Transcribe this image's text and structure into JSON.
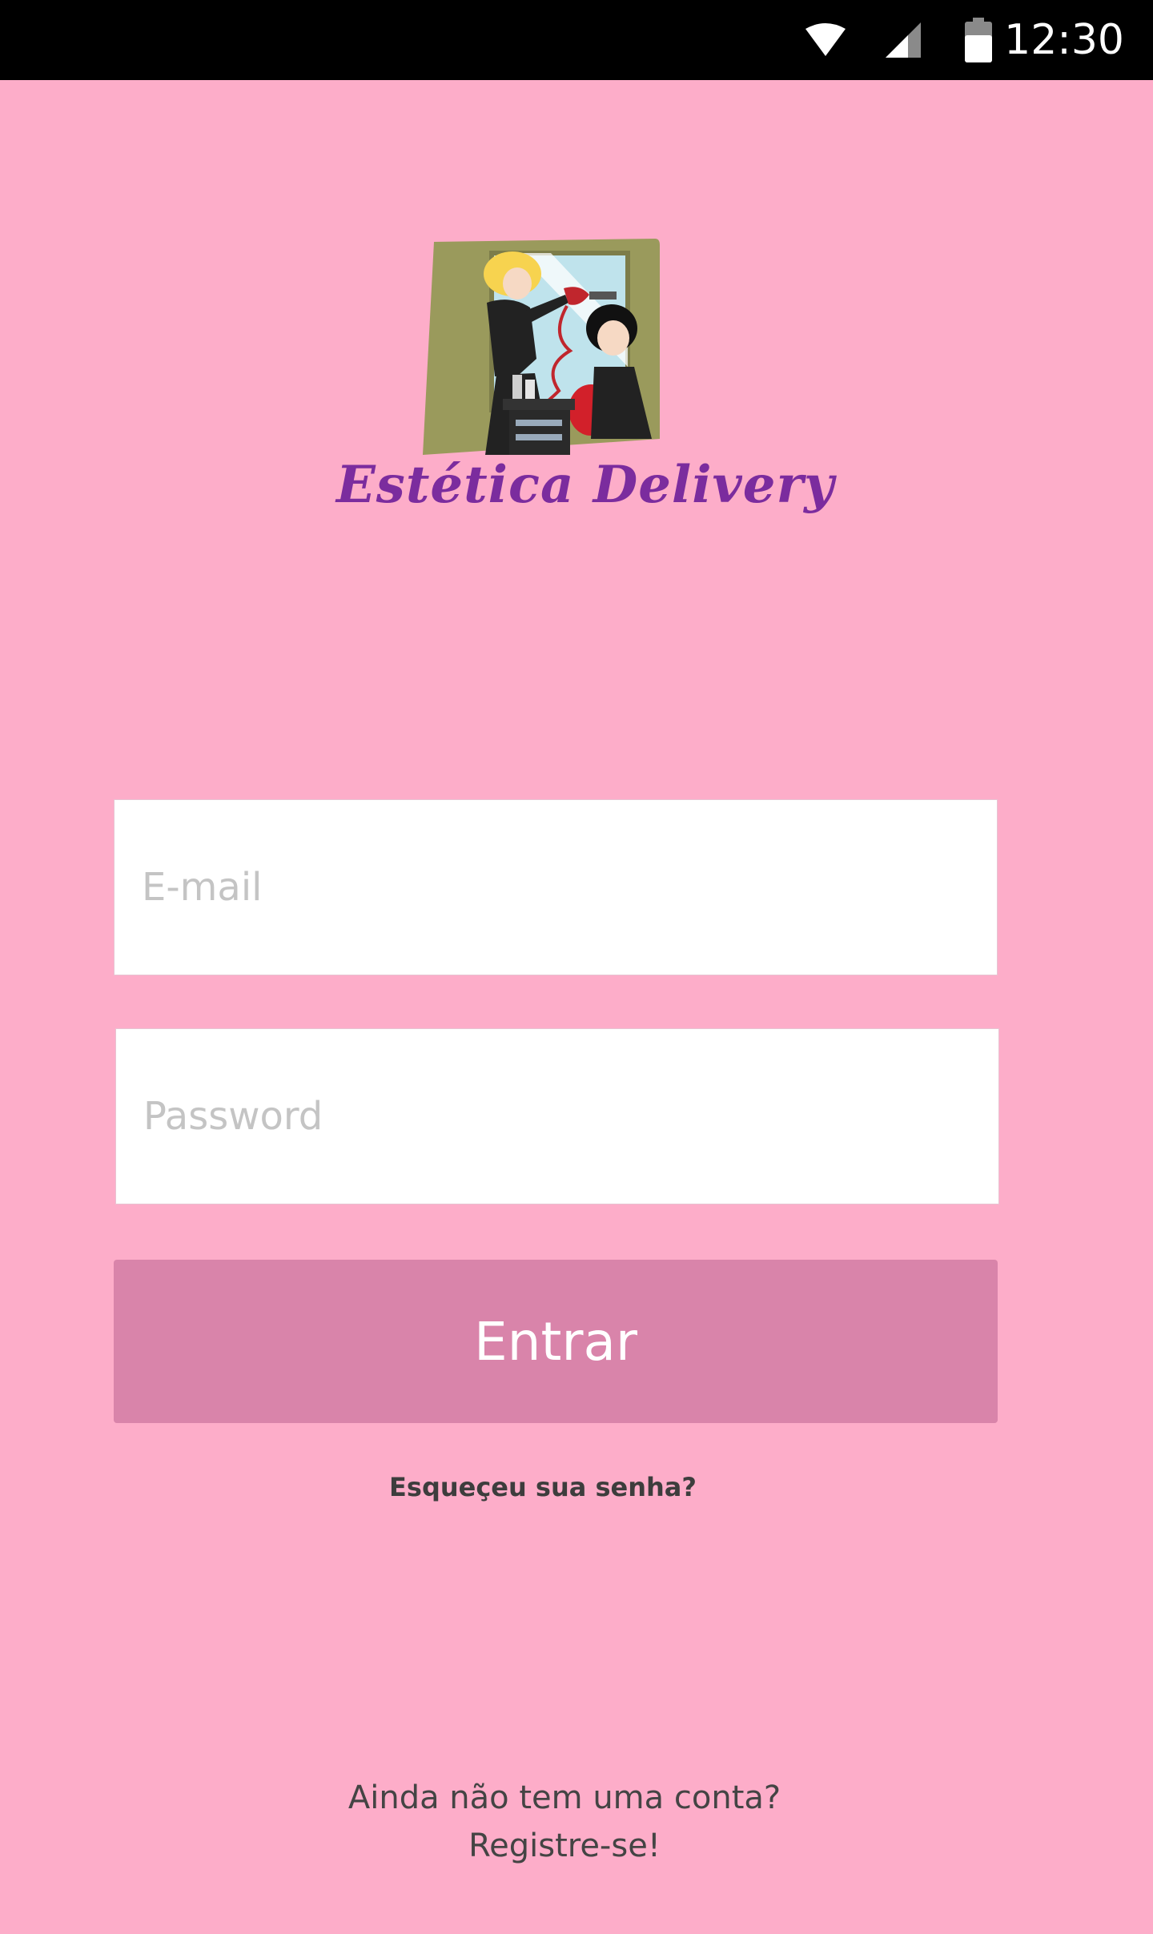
{
  "status_bar": {
    "time": "12:30",
    "icons": [
      "wifi-icon",
      "signal-icon",
      "battery-icon"
    ]
  },
  "logo": {
    "brand_name": "Estética Delivery"
  },
  "form": {
    "email_placeholder": "E-mail",
    "email_value": "",
    "password_placeholder": "Password",
    "password_value": "",
    "submit_label": "Entrar",
    "forgot_password": "Esqueçeu sua senha?"
  },
  "signup": {
    "question": "Ainda não tem uma conta?",
    "link": "Registre-se!"
  },
  "colors": {
    "background": "#fdadc9",
    "button": "#d984aa",
    "brand_text": "#7b2c9e",
    "status_bar": "#000000"
  }
}
